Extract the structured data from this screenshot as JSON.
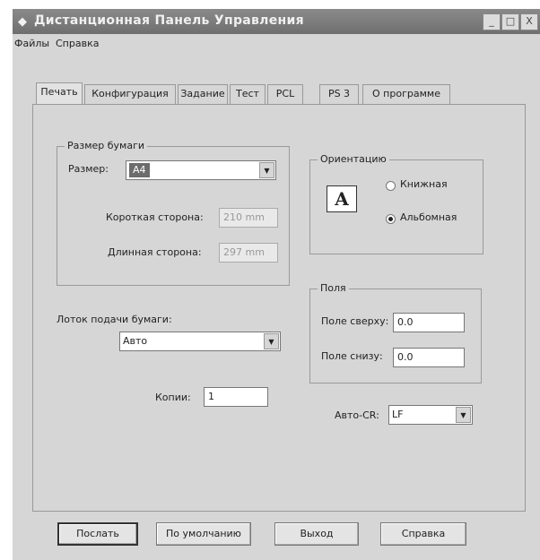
{
  "window": {
    "title": "Дистанционная Панель Управления",
    "controls": [
      "_",
      "□",
      "X"
    ]
  },
  "menu": [
    "Файлы",
    "Справка"
  ],
  "tabs": [
    "Печать",
    "Конфигурация",
    "Задание",
    "Тест",
    "PCL",
    "PS 3",
    "О программе"
  ],
  "paper": {
    "group_label": "Размер бумаги",
    "size_label": "Размер:",
    "size_value": "A4",
    "short_label": "Короткая сторона:",
    "short_value": "210 mm",
    "long_label": "Длинная сторона:",
    "long_value": "297 mm"
  },
  "orientation": {
    "group_label": "Ориентацию",
    "icon_letter": "A",
    "portrait": "Книжная",
    "landscape": "Альбомная",
    "selected": "landscape"
  },
  "tray": {
    "label": "Лоток подачи бумаги:",
    "value": "Авто"
  },
  "margins": {
    "group_label": "Поля",
    "top_label": "Поле сверху:",
    "top_value": "0.0",
    "bottom_label": "Поле снизу:",
    "bottom_value": "0.0"
  },
  "copies": {
    "label": "Копии:",
    "value": "1"
  },
  "autocr": {
    "label": "Авто-CR:",
    "value": "LF"
  },
  "buttons": {
    "send": "Послать",
    "default": "По умолчанию",
    "exit": "Выход",
    "help": "Справка"
  }
}
